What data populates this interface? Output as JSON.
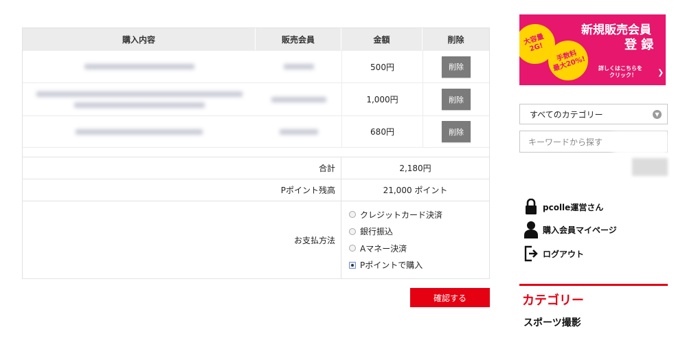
{
  "cart": {
    "headers": [
      "購入内容",
      "販売会員",
      "金額",
      "削除"
    ],
    "rows": [
      {
        "price": "500円",
        "delete_label": "削除"
      },
      {
        "price": "1,000円",
        "delete_label": "削除"
      },
      {
        "price": "680円",
        "delete_label": "削除"
      }
    ],
    "total_label": "合計",
    "total_value": "2,180円",
    "points_label": "Pポイント残高",
    "points_value": "21,000 ポイント",
    "payment_label": "お支払方法",
    "payment_options": [
      {
        "label": "クレジットカード決済",
        "selected": false
      },
      {
        "label": "銀行振込",
        "selected": false
      },
      {
        "label": "Aマネー決済",
        "selected": false
      },
      {
        "label": "Pポイントで購入",
        "selected": true
      }
    ],
    "confirm_label": "確認する"
  },
  "sidebar": {
    "banner": {
      "title": "新規販売会員",
      "title2": "登 録",
      "badge1_line1": "大容量",
      "badge1_line2": "2G!",
      "badge2_line1": "手数料",
      "badge2_line2": "最大20%!",
      "cta_line1": "詳しくはこちらを",
      "cta_line2": "クリック！"
    },
    "category_select": "すべてのカテゴリー",
    "search_placeholder": "キーワードから探す",
    "user_name": "pcolle運営さん",
    "mypage_label": "購入会員マイページ",
    "logout_label": "ログアウト",
    "category_heading": "カテゴリー",
    "category_first": "スポーツ撮影"
  },
  "colors": {
    "accent": "#e50012",
    "banner": "#e6176d",
    "delete_button": "#7b7b7b"
  },
  "icons": [
    "lock-icon",
    "user-icon",
    "logout-icon",
    "chevron-down-icon",
    "radio-icon"
  ]
}
